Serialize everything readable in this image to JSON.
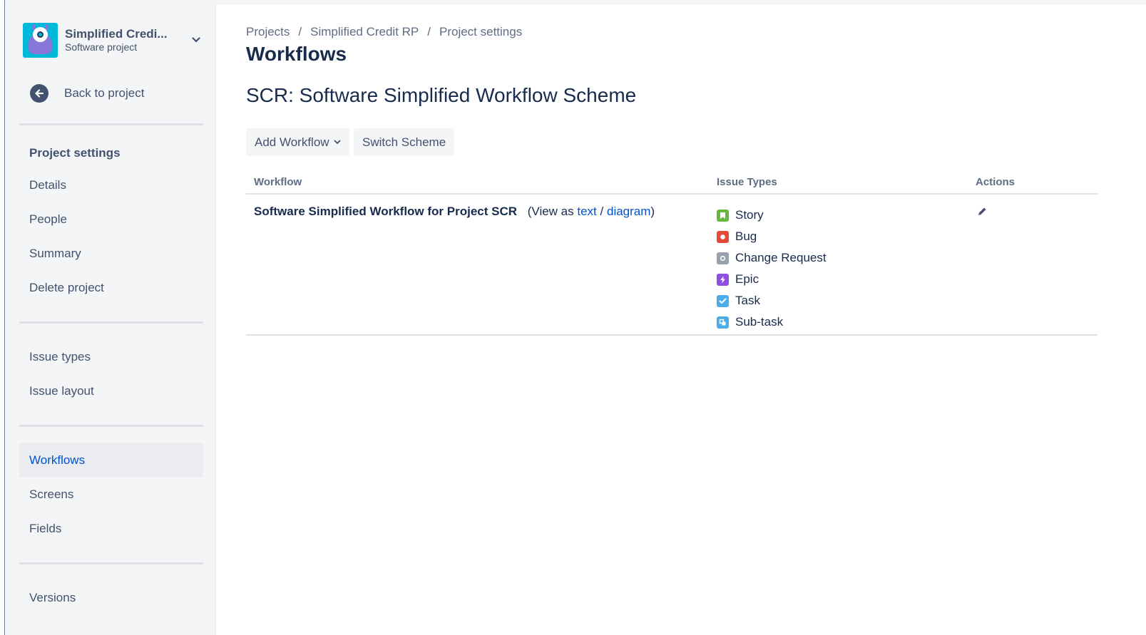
{
  "sidebar": {
    "project_name": "Simplified Credi...",
    "project_type": "Software project",
    "back_label": "Back to project",
    "section_title": "Project settings",
    "group1": [
      "Details",
      "People",
      "Summary",
      "Delete project"
    ],
    "group2": [
      "Issue types",
      "Issue layout"
    ],
    "group3": [
      "Workflows",
      "Screens",
      "Fields"
    ],
    "group4": [
      "Versions"
    ],
    "active_item": "Workflows"
  },
  "breadcrumb": [
    "Projects",
    "Simplified Credit RP",
    "Project settings"
  ],
  "breadcrumb_separator": "/",
  "page_title": "Workflows",
  "scheme_title": "SCR: Software Simplified Workflow Scheme",
  "buttons": {
    "add_workflow": "Add Workflow",
    "switch_scheme": "Switch Scheme"
  },
  "table": {
    "headers": [
      "Workflow",
      "Issue Types",
      "Actions"
    ],
    "row": {
      "workflow_name": "Software Simplified Workflow for Project SCR",
      "view_as_prefix": "(View as",
      "view_text": "text",
      "view_sep": "/",
      "view_diagram": "diagram",
      "view_suffix": ")",
      "issue_types": [
        {
          "label": "Story",
          "icon": "story-icon",
          "color": "#63ba3c"
        },
        {
          "label": "Bug",
          "icon": "bug-icon",
          "color": "#e5493a"
        },
        {
          "label": "Change Request",
          "icon": "change-request-icon",
          "color": "#97a0af"
        },
        {
          "label": "Epic",
          "icon": "epic-icon",
          "color": "#904ee2"
        },
        {
          "label": "Task",
          "icon": "task-icon",
          "color": "#4bade8"
        },
        {
          "label": "Sub-task",
          "icon": "subtask-icon",
          "color": "#4bade8"
        }
      ],
      "action_icon": "edit-pencil-icon"
    }
  },
  "colors": {
    "link": "#0052cc",
    "sidebar_bg": "#f4f5f7",
    "active_nav_bg": "#ebecf0",
    "text": "#172b4d"
  }
}
